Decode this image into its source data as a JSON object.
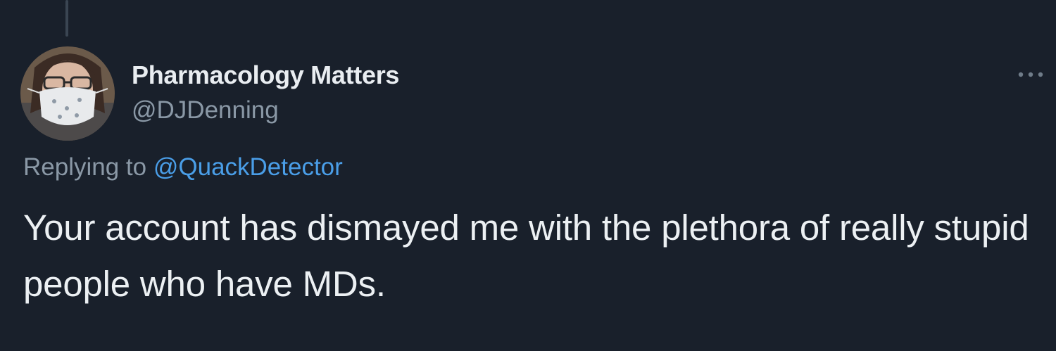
{
  "author": {
    "display_name": "Pharmacology Matters",
    "handle": "@DJDenning",
    "avatar_icon": "user-avatar-photo-masked-person"
  },
  "reply": {
    "prefix": "Replying to",
    "target": "@QuackDetector"
  },
  "tweet": {
    "text": "Your account has dismayed me with the plethora of really stupid people who have MDs."
  },
  "more_icon": "more-horizontal-icon",
  "colors": {
    "background": "#19202b",
    "primary_text": "#ecf0f3",
    "secondary_text": "#8a98a6",
    "link": "#4a9ee8",
    "thread_line": "#3a4552"
  }
}
